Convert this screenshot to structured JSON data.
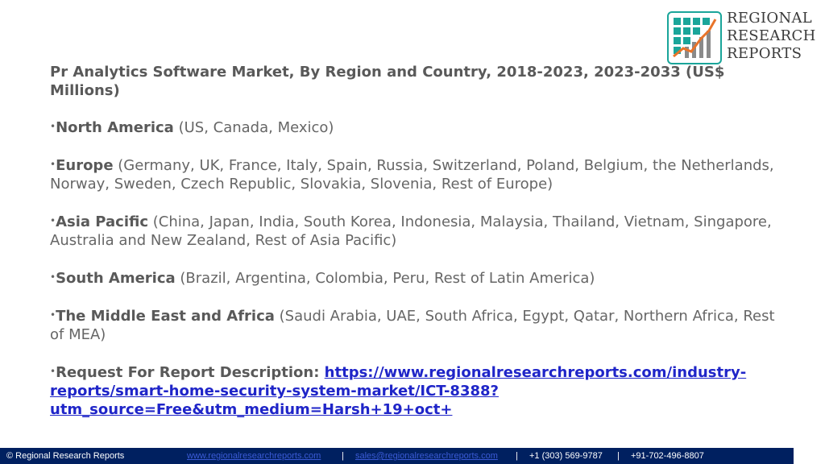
{
  "logo": {
    "line1": "REGIONAL",
    "line2": "RESEARCH",
    "line3": "REPORTS",
    "colors": {
      "teal": "#1aa59a",
      "orange": "#e8742a",
      "gray": "#8a8a8a"
    }
  },
  "title": "Pr Analytics Software Market, By Region and Country, 2018-2023, 2023-2033 (US$ Millions)",
  "bullet_glyph": "•",
  "regions": [
    {
      "name": "North America",
      "countries": " (US, Canada, Mexico)"
    },
    {
      "name": "Europe",
      "countries": " (Germany, UK, France, Italy, Spain, Russia, Switzerland, Poland, Belgium, the Netherlands, Norway, Sweden, Czech Republic, Slovakia, Slovenia, Rest of Europe)"
    },
    {
      "name": "Asia Pacific",
      "countries": " (China, Japan, India, South Korea, Indonesia, Malaysia, Thailand, Vietnam, Singapore, Australia and New Zealand, Rest of Asia Pacific)"
    },
    {
      "name": "South America",
      "countries": " (Brazil, Argentina, Colombia, Peru, Rest of Latin America)"
    },
    {
      "name": "The Middle East and Africa",
      "countries": " (Saudi Arabia, UAE, South Africa, Egypt, Qatar, Northern Africa, Rest of MEA)"
    }
  ],
  "request": {
    "label": "Request For Report Description: ",
    "url": "https://www.regionalresearchreports.com/industry-reports/smart-home-security-system-market/ICT-8388?utm_source=Free&utm_medium=Harsh+19+oct+"
  },
  "footer": {
    "copyright": "© Regional Research Reports",
    "website": "www.regionalresearchreports.com",
    "sep": "|",
    "email": "sales@regionalresearchreports.com",
    "phone1": "+1 (303) 569-9787",
    "phone2": "+91-702-496-8807",
    "bg_color": "#002060"
  }
}
